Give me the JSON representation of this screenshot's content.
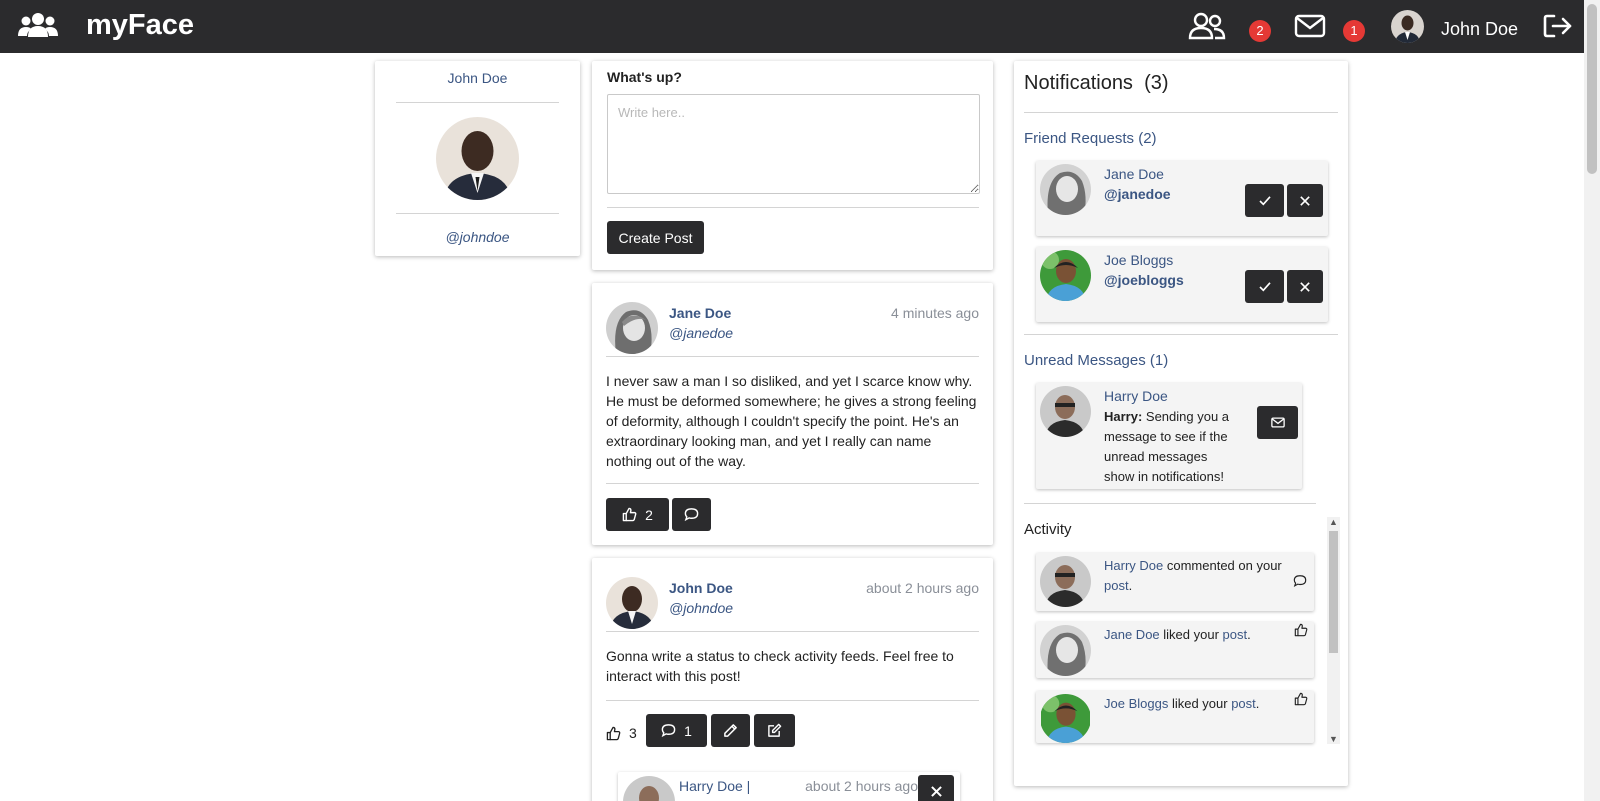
{
  "navbar": {
    "brand": "myFace",
    "friend_request_count": "2",
    "message_count": "1",
    "user_name": "John Doe",
    "icons": [
      "users-icon",
      "friends-icon",
      "mail-icon",
      "logout-icon"
    ]
  },
  "profile": {
    "name": "John Doe",
    "handle": "@johndoe"
  },
  "composer": {
    "title": "What's up?",
    "placeholder": "Write here..",
    "value": "",
    "submit_label": "Create Post"
  },
  "posts": [
    {
      "author": "Jane Doe",
      "handle": "@janedoe",
      "time": "4 minutes ago",
      "body": "I never saw a man I so disliked, and yet I scarce know why. He must be deformed somewhere; he gives a strong feeling of deformity, although I couldn't specify the point. He's an extraordinary looking man, and yet I really can name nothing out of the way.",
      "likes": "2"
    },
    {
      "author": "John Doe",
      "handle": "@johndoe",
      "time": "about 2 hours ago",
      "body": "Gonna write a status to check activity feeds. Feel free to interact with this post!",
      "likes": "3",
      "comments": "1",
      "comment_preview": {
        "author": "Harry Doe |",
        "time": "about 2 hours ago"
      }
    }
  ],
  "notifications": {
    "title": "Notifications",
    "count": "(3)",
    "friend_requests": {
      "title": "Friend Requests (2)",
      "items": [
        {
          "name": "Jane Doe",
          "handle": "@janedoe"
        },
        {
          "name": "Joe Bloggs",
          "handle": "@joebloggs"
        }
      ]
    },
    "unread_messages": {
      "title": "Unread Messages (1)",
      "items": [
        {
          "name": "Harry Doe",
          "sender": "Harry:",
          "text": " Sending you a message to see if the unread messages show in notifications!"
        }
      ]
    },
    "activity": {
      "title": "Activity",
      "items": [
        {
          "actor": "Harry Doe",
          "action": " commented on your ",
          "target": "post",
          "end": ".",
          "icon": "comment-icon"
        },
        {
          "actor": "Jane Doe",
          "action": " liked your ",
          "target": "post",
          "end": ".",
          "icon": "thumbs-up-icon"
        },
        {
          "actor": "Joe Bloggs",
          "action": " liked your ",
          "target": "post",
          "end": ".",
          "icon": "thumbs-up-icon"
        }
      ]
    }
  },
  "colors": {
    "navbar": "#2b2b2d",
    "link": "#3b5683",
    "badge": "#e53935",
    "button": "#2b2b2d"
  }
}
